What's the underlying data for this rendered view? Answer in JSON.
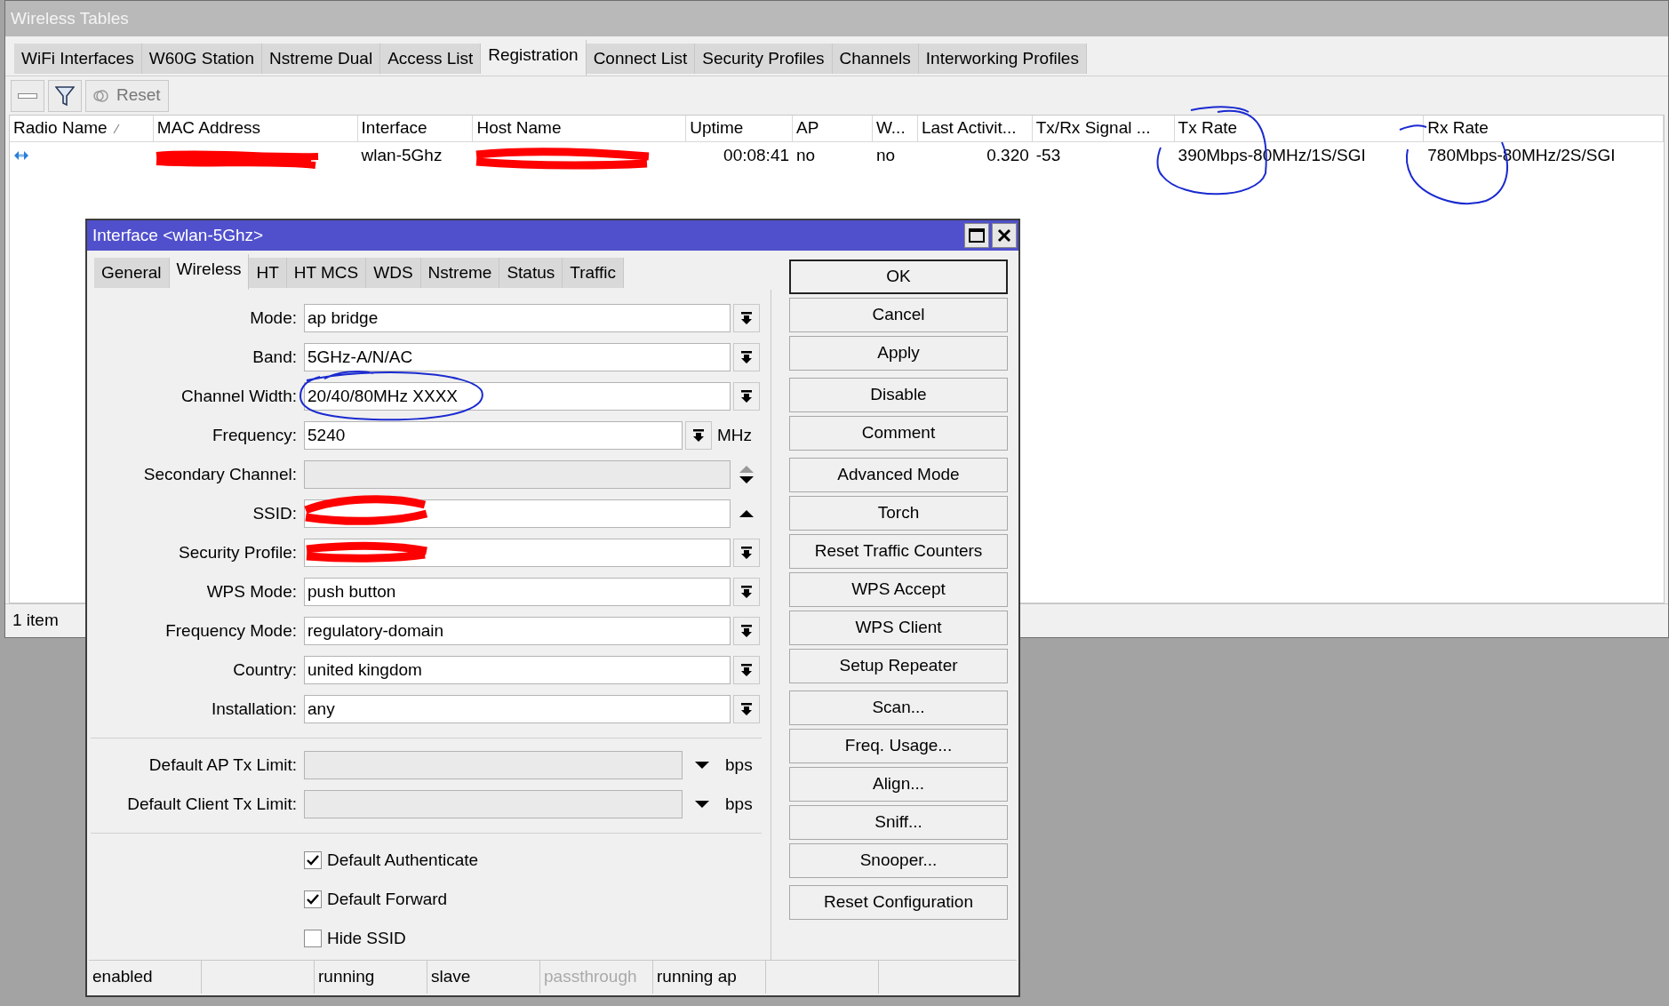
{
  "window": {
    "title": "Wireless Tables"
  },
  "tabs": [
    {
      "label": "WiFi Interfaces",
      "selected": false
    },
    {
      "label": "W60G Station",
      "selected": false
    },
    {
      "label": "Nstreme Dual",
      "selected": false
    },
    {
      "label": "Access List",
      "selected": false
    },
    {
      "label": "Registration",
      "selected": true
    },
    {
      "label": "Connect List",
      "selected": false
    },
    {
      "label": "Security Profiles",
      "selected": false
    },
    {
      "label": "Channels",
      "selected": false
    },
    {
      "label": "Interworking Profiles",
      "selected": false
    }
  ],
  "toolbar": {
    "reset_label": "Reset"
  },
  "table": {
    "columns": [
      {
        "label": "Radio Name",
        "sorted": true
      },
      {
        "label": "MAC Address",
        "sorted": false
      },
      {
        "label": "Interface",
        "sorted": false
      },
      {
        "label": "Host Name",
        "sorted": false
      },
      {
        "label": "Uptime",
        "sorted": false
      },
      {
        "label": "AP",
        "sorted": false
      },
      {
        "label": "W...",
        "sorted": false
      },
      {
        "label": "Last Activit...",
        "sorted": false
      },
      {
        "label": "Tx/Rx Signal ...",
        "sorted": false
      },
      {
        "label": "Tx Rate",
        "sorted": false
      },
      {
        "label": "Rx Rate",
        "sorted": false
      }
    ],
    "rows": [
      {
        "interface": "wlan-5Ghz",
        "uptime": "00:08:41",
        "ap": "no",
        "wds": "no",
        "last_activity": "0.320",
        "signal": "-53",
        "tx_rate": "390Mbps-80MHz/1S/SGI",
        "rx_rate": "780Mbps-80MHz/2S/SGI"
      }
    ]
  },
  "status_bar": {
    "count": "1 item"
  },
  "dialog": {
    "title": "Interface <wlan-5Ghz>",
    "tabs": [
      {
        "label": "General",
        "selected": false
      },
      {
        "label": "Wireless",
        "selected": true
      },
      {
        "label": "HT",
        "selected": false
      },
      {
        "label": "HT MCS",
        "selected": false
      },
      {
        "label": "WDS",
        "selected": false
      },
      {
        "label": "Nstreme",
        "selected": false
      },
      {
        "label": "Status",
        "selected": false
      },
      {
        "label": "Traffic",
        "selected": false
      }
    ],
    "field_groups": [
      [
        {
          "kind": "select",
          "label": "Mode:",
          "value": "ap bridge",
          "disabled": false
        },
        {
          "kind": "select",
          "label": "Band:",
          "value": "5GHz-A/N/AC",
          "disabled": false
        },
        {
          "kind": "select",
          "label": "Channel Width:",
          "value": "20/40/80MHz XXXX",
          "disabled": false
        },
        {
          "kind": "select",
          "label": "Frequency:",
          "value": "5240",
          "unit": "MHz",
          "disabled": false
        },
        {
          "kind": "spin",
          "label": "Secondary Channel:",
          "disabled": true
        },
        {
          "kind": "history",
          "label": "SSID:",
          "disabled": false
        },
        {
          "kind": "select",
          "label": "Security Profile:",
          "disabled": false
        },
        {
          "kind": "select",
          "label": "WPS Mode:",
          "value": "push button",
          "disabled": false
        },
        {
          "kind": "select",
          "label": "Frequency Mode:",
          "value": "regulatory-domain",
          "disabled": false
        },
        {
          "kind": "select",
          "label": "Country:",
          "value": "united kingdom",
          "disabled": false
        },
        {
          "kind": "select",
          "label": "Installation:",
          "value": "any",
          "disabled": false
        }
      ],
      [
        {
          "kind": "limit",
          "label": "Default AP Tx Limit:",
          "unit": "bps",
          "disabled": true
        },
        {
          "kind": "limit",
          "label": "Default Client Tx Limit:",
          "unit": "bps",
          "disabled": true
        }
      ]
    ],
    "checkboxes": [
      {
        "label": "Default Authenticate",
        "checked": true
      },
      {
        "label": "Default Forward",
        "checked": true
      },
      {
        "label": "Hide SSID",
        "checked": false
      }
    ],
    "button_groups": [
      [
        {
          "label": "OK",
          "default": true
        },
        {
          "label": "Cancel",
          "default": false
        },
        {
          "label": "Apply",
          "default": false
        }
      ],
      [
        {
          "label": "Disable",
          "default": false
        },
        {
          "label": "Comment",
          "default": false
        }
      ],
      [
        {
          "label": "Advanced Mode",
          "default": false
        },
        {
          "label": "Torch",
          "default": false
        },
        {
          "label": "Reset Traffic Counters",
          "default": false
        },
        {
          "label": "WPS Accept",
          "default": false
        },
        {
          "label": "WPS Client",
          "default": false
        },
        {
          "label": "Setup Repeater",
          "default": false
        }
      ],
      [
        {
          "label": "Scan...",
          "default": false
        },
        {
          "label": "Freq. Usage...",
          "default": false
        },
        {
          "label": "Align...",
          "default": false
        },
        {
          "label": "Sniff...",
          "default": false
        },
        {
          "label": "Snooper...",
          "default": false
        }
      ],
      [
        {
          "label": "Reset Configuration",
          "default": false
        }
      ]
    ],
    "status_cells": [
      {
        "kind": "text",
        "text": "enabled",
        "dimmed": false
      },
      {
        "kind": "blank"
      },
      {
        "kind": "text",
        "text": "running",
        "dimmed": false
      },
      {
        "kind": "text",
        "text": "slave",
        "dimmed": false
      },
      {
        "kind": "text",
        "text": "passthrough",
        "dimmed": true
      },
      {
        "kind": "text",
        "text": "running ap",
        "dimmed": false
      },
      {
        "kind": "blank"
      }
    ]
  }
}
